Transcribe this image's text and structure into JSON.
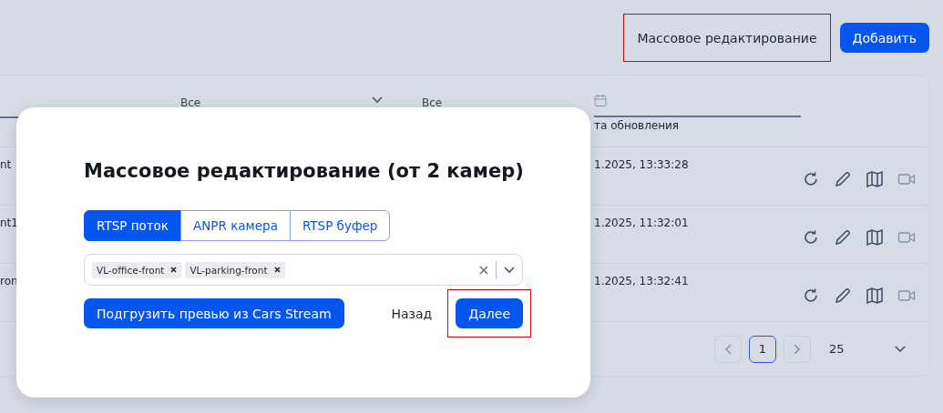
{
  "header": {
    "buttons": [
      {
        "label": "Массовое редактирование",
        "kind": "text",
        "highlighted": true
      },
      {
        "label": "Добавить",
        "kind": "primary",
        "highlighted": false
      }
    ]
  },
  "table": {
    "filters": [
      {
        "kind": "select",
        "value": "Все"
      },
      {
        "kind": "select",
        "value": "Все"
      },
      {
        "kind": "date",
        "label": "та обновления"
      }
    ],
    "rows": [
      {
        "name": "nt",
        "updated": "1.2025, 13:33:28"
      },
      {
        "name": "nt1",
        "updated": "1.2025, 11:32:01"
      },
      {
        "name": "ron",
        "updated": "1.2025, 13:32:41"
      }
    ],
    "pagination": {
      "pages": [
        {
          "label": "1",
          "selected": true
        }
      ],
      "page_size": "25"
    }
  },
  "modal": {
    "title": "Массовое редактирование (от 2 камер)",
    "tabs": [
      {
        "label": "RTSP поток",
        "selected": true
      },
      {
        "label": "ANPR камера",
        "selected": false
      },
      {
        "label": "RTSP буфер",
        "selected": false
      }
    ],
    "tags": [
      "VL-office-front",
      "VL-parking-front"
    ],
    "buttons": [
      {
        "label": "Подгрузить превью из Cars Stream",
        "kind": "primary",
        "highlighted": false
      },
      {
        "label": "Назад",
        "kind": "text",
        "highlighted": false
      },
      {
        "label": "Далее",
        "kind": "primary",
        "highlighted": true
      }
    ]
  }
}
